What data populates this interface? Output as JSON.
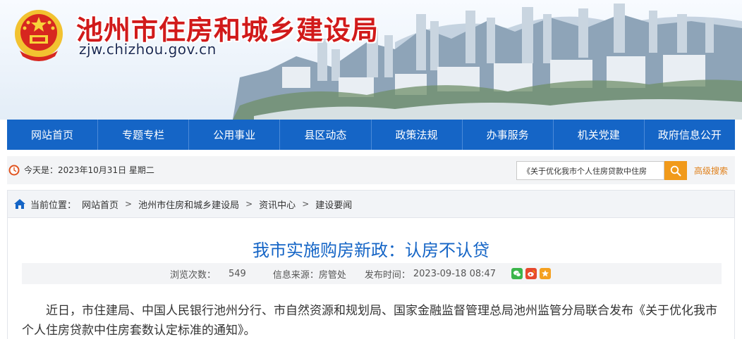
{
  "header": {
    "site_title": "池州市住房和城乡建设局",
    "site_url": "zjw.chizhou.gov.cn"
  },
  "nav": {
    "items": [
      {
        "label": "网站首页"
      },
      {
        "label": "专题专栏"
      },
      {
        "label": "公用事业"
      },
      {
        "label": "县区动态"
      },
      {
        "label": "政策法规"
      },
      {
        "label": "办事服务"
      },
      {
        "label": "机关党建"
      },
      {
        "label": "政府信息公开"
      }
    ]
  },
  "infobar": {
    "date_text": "今天是：2023年10月31日 星期二",
    "search_value": "《关于优化我市个人住房贷款中住房",
    "advanced_search_label": "高级搜索"
  },
  "breadcrumb": {
    "label": "当前位置：",
    "items": [
      "网站首页",
      "池州市住房和城乡建设局",
      "资讯中心",
      "建设要闻"
    ],
    "separator": ">"
  },
  "article": {
    "title": "我市实施购房新政：认房不认贷",
    "views_label": "浏览次数：",
    "views_value": "549",
    "source_label": "信息来源：",
    "source_value": "房管处",
    "publish_label": "发布时间：",
    "publish_value": "2023-09-18 08:47",
    "body": "近日，市住建局、中国人民银行池州分行、市自然资源和规划局、国家金融监督管理总局池州监管分局联合发布《关于优化我市个人住房贷款中住房套数认定标准的通知》。"
  },
  "colors": {
    "nav_blue": "#1565c6",
    "title_red": "#d11a1a",
    "search_orange": "#f19a1b",
    "wechat_green": "#3bb54a",
    "weibo_red": "#e6492d",
    "favorite_orange": "#f4a020"
  }
}
